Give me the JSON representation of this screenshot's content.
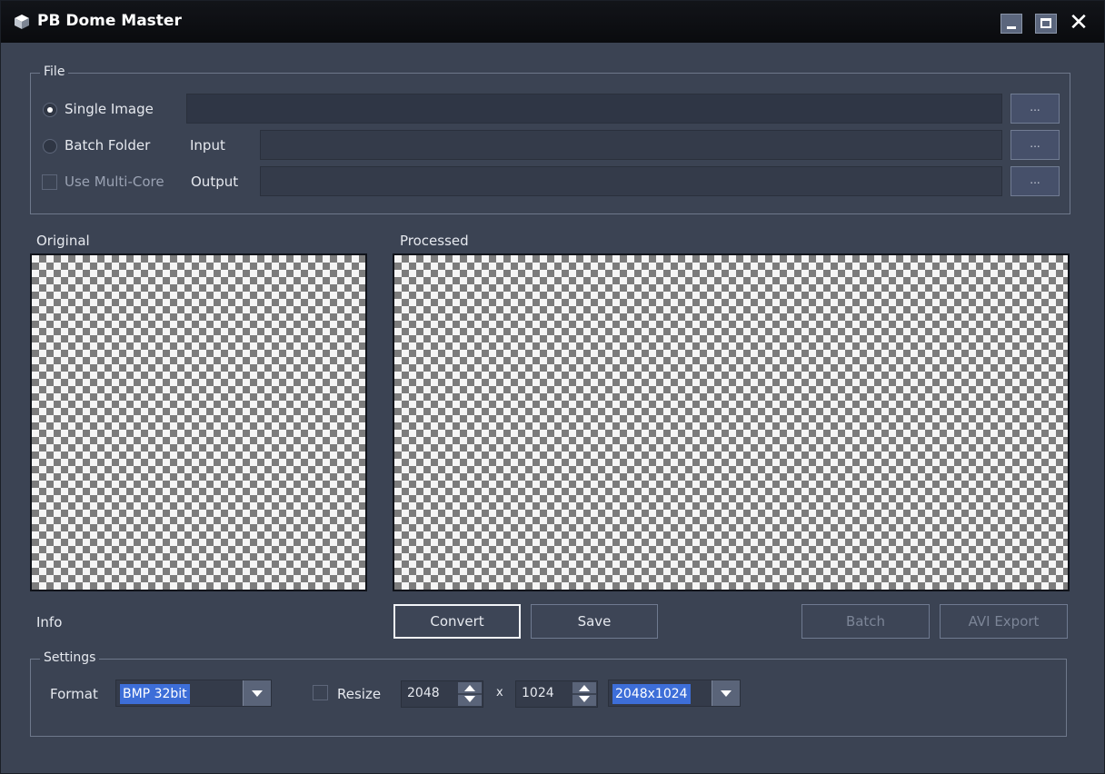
{
  "window": {
    "title": "PB Dome Master",
    "close_glyph": "✕"
  },
  "file": {
    "legend": "File",
    "single_image": {
      "label": "Single Image",
      "selected": true,
      "path": ""
    },
    "batch_folder": {
      "label": "Batch Folder",
      "selected": false
    },
    "input": {
      "label": "Input",
      "path": ""
    },
    "use_multicore": {
      "label": "Use Multi-Core",
      "checked": false
    },
    "output": {
      "label": "Output",
      "path": ""
    },
    "browse_label": "..."
  },
  "panels": {
    "original_label": "Original",
    "processed_label": "Processed",
    "info_label": "Info"
  },
  "actions": {
    "convert": "Convert",
    "save": "Save",
    "batch": "Batch",
    "avi_export": "AVI Export"
  },
  "settings": {
    "legend": "Settings",
    "format_label": "Format",
    "format_value": "BMP 32bit",
    "resize_label": "Resize",
    "resize_checked": false,
    "width": "2048",
    "times": "x",
    "height": "1024",
    "preset_value": "2048x1024"
  },
  "colors": {
    "background": "#3b4353",
    "titlebar": "#0a0b0e",
    "selection": "#3d6ed8"
  }
}
